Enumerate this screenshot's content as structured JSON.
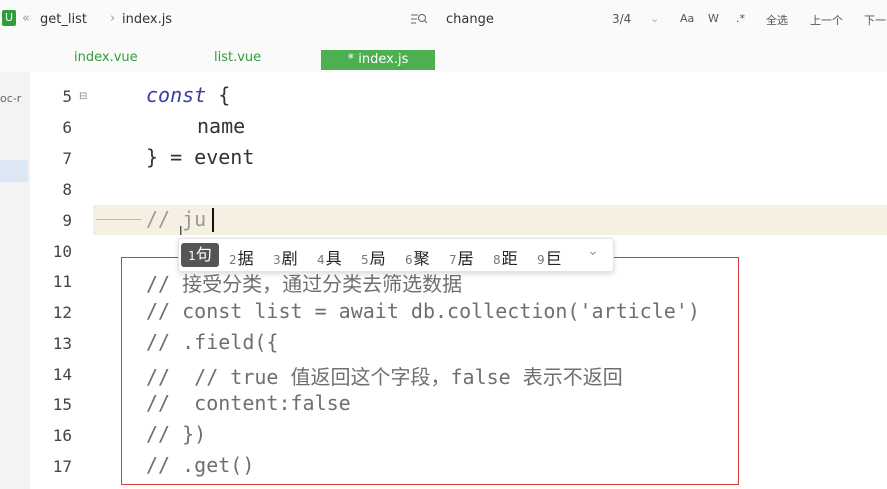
{
  "header": {
    "breadcrumb": [
      "get_list",
      "index.js"
    ],
    "app_icon_letter": "U",
    "find_query": "change",
    "find_count": "3/4",
    "toolbar": {
      "match_case": "Aa",
      "word": "W",
      "regex": ".*",
      "select_all": "全选",
      "prev": "上一个",
      "next": "下一"
    }
  },
  "tabs": [
    {
      "label": "index.vue",
      "active": false
    },
    {
      "label": "list.vue",
      "active": false
    },
    {
      "label": "* index.js",
      "active": true
    }
  ],
  "sidebar": {
    "partial_label": "oc-r"
  },
  "editor": {
    "line_numbers": [
      "5",
      "6",
      "7",
      "8",
      "9",
      "10",
      "11",
      "12",
      "13",
      "14",
      "15",
      "16",
      "17"
    ],
    "lines": {
      "l5_kw": "const",
      "l5_brace": " {",
      "l6": "name",
      "l7": "} = event",
      "l9": "// ju",
      "l11": "// 接受分类，通过分类去筛选数据",
      "l12": "// const list = await db.collection('article')",
      "l13": "// .field({",
      "l14": "//  // true 值返回这个字段，false 表示不返回",
      "l15": "//  content:false",
      "l16": "// })",
      "l17": "// .get()"
    }
  },
  "ime": {
    "candidates": [
      {
        "n": "1",
        "c": "句"
      },
      {
        "n": "2",
        "c": "据"
      },
      {
        "n": "3",
        "c": "剧"
      },
      {
        "n": "4",
        "c": "具"
      },
      {
        "n": "5",
        "c": "局"
      },
      {
        "n": "6",
        "c": "聚"
      },
      {
        "n": "7",
        "c": "居"
      },
      {
        "n": "8",
        "c": "距"
      },
      {
        "n": "9",
        "c": "巨"
      }
    ],
    "more": "⌄"
  },
  "colors": {
    "accent": "#4caf50",
    "highlight_box": "#d43a3a",
    "keyword": "#3b3ba3"
  }
}
